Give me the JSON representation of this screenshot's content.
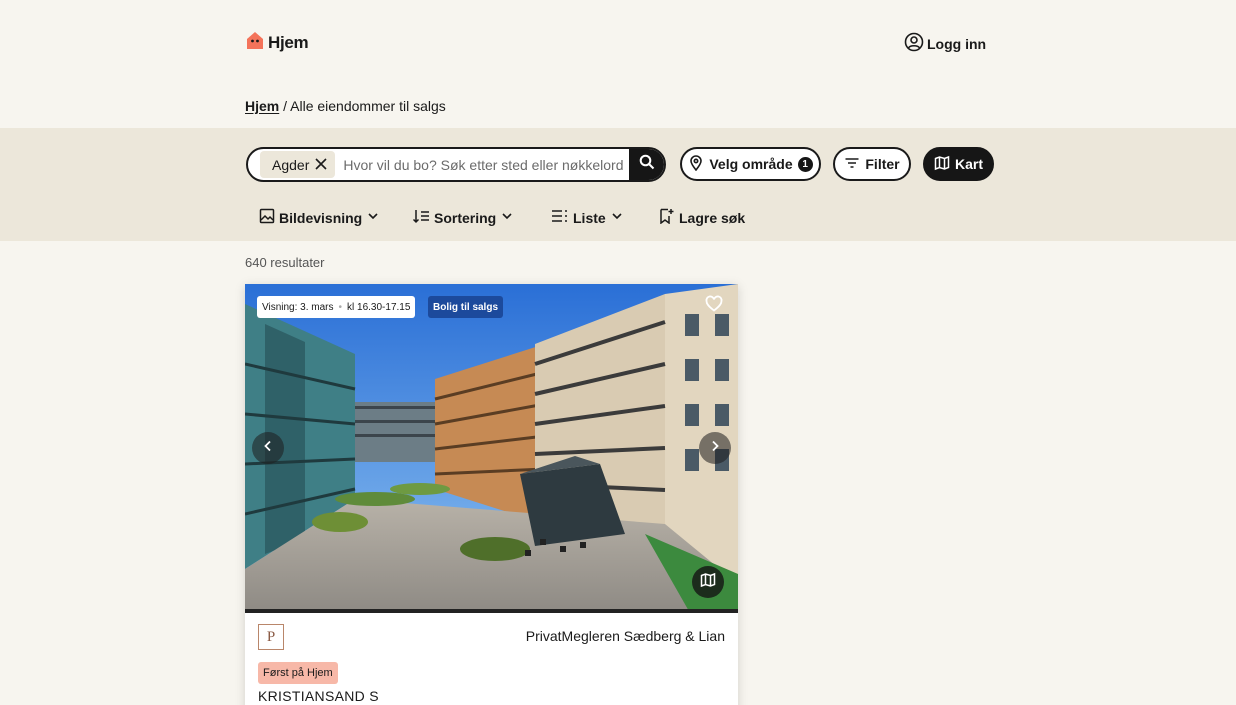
{
  "header": {
    "logo_text": "Hjem",
    "login_label": "Logg inn"
  },
  "breadcrumb": {
    "home": "Hjem",
    "separator": "/",
    "current": "Alle eiendommer til salgs"
  },
  "search": {
    "chip_label": "Agder",
    "placeholder": "Hvor vil du bo? Søk etter sted eller nøkkelord",
    "value": ""
  },
  "filters": {
    "area_label": "Velg område",
    "area_count": "1",
    "filter_label": "Filter",
    "map_label": "Kart"
  },
  "toolbar": {
    "view_label": "Bildevisning",
    "sort_label": "Sortering",
    "list_label": "Liste",
    "save_label": "Lagre søk"
  },
  "results": {
    "text": "640 resultater"
  },
  "listing": {
    "viewing_label": "Visning: 3. mars",
    "viewing_time": "kl 16.30-17.15",
    "status_tag": "Bolig til salgs",
    "agency_logo_letter": "P",
    "agency": "PrivatMegleren Sædberg & Lian",
    "badge": "Først på Hjem",
    "location": "KRISTIANSAND S"
  },
  "colors": {
    "background": "#f7f5ef",
    "band": "#ece7da",
    "accent_logo": "#f4735a",
    "status_tag": "#1c4a9c",
    "first_tag": "#f7b8a8",
    "dark": "#161616"
  }
}
